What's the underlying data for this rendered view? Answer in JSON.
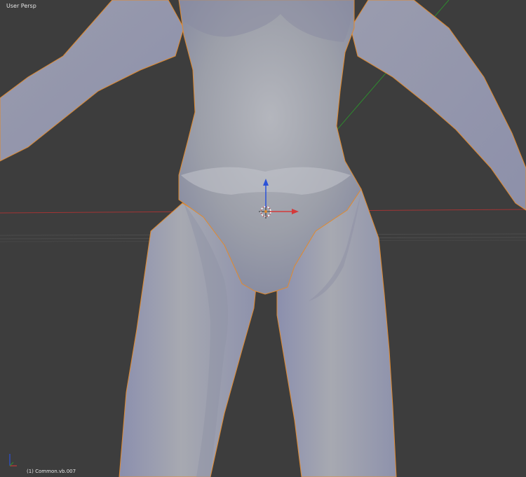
{
  "viewport": {
    "view_label": "User Persp",
    "object_label": "(1) Common.vb.007"
  },
  "colors": {
    "background": "#3d3d3d",
    "grid_line": "#4a4a4a",
    "x_axis": "#c33a3a",
    "y_axis": "#3a9a3a",
    "z_axis": "#2b52d8",
    "selection_outline": "#e08a2f",
    "mesh_fill": "#a6a9b2",
    "mesh_shadow": "#8a8d9a",
    "mesh_highlight": "#c8cad1"
  },
  "icons": {
    "transform_manipulator": "translate-gizmo-icon",
    "origin_cursor": "3d-cursor-icon",
    "axis_indicator": "axes-orientation-icon"
  }
}
